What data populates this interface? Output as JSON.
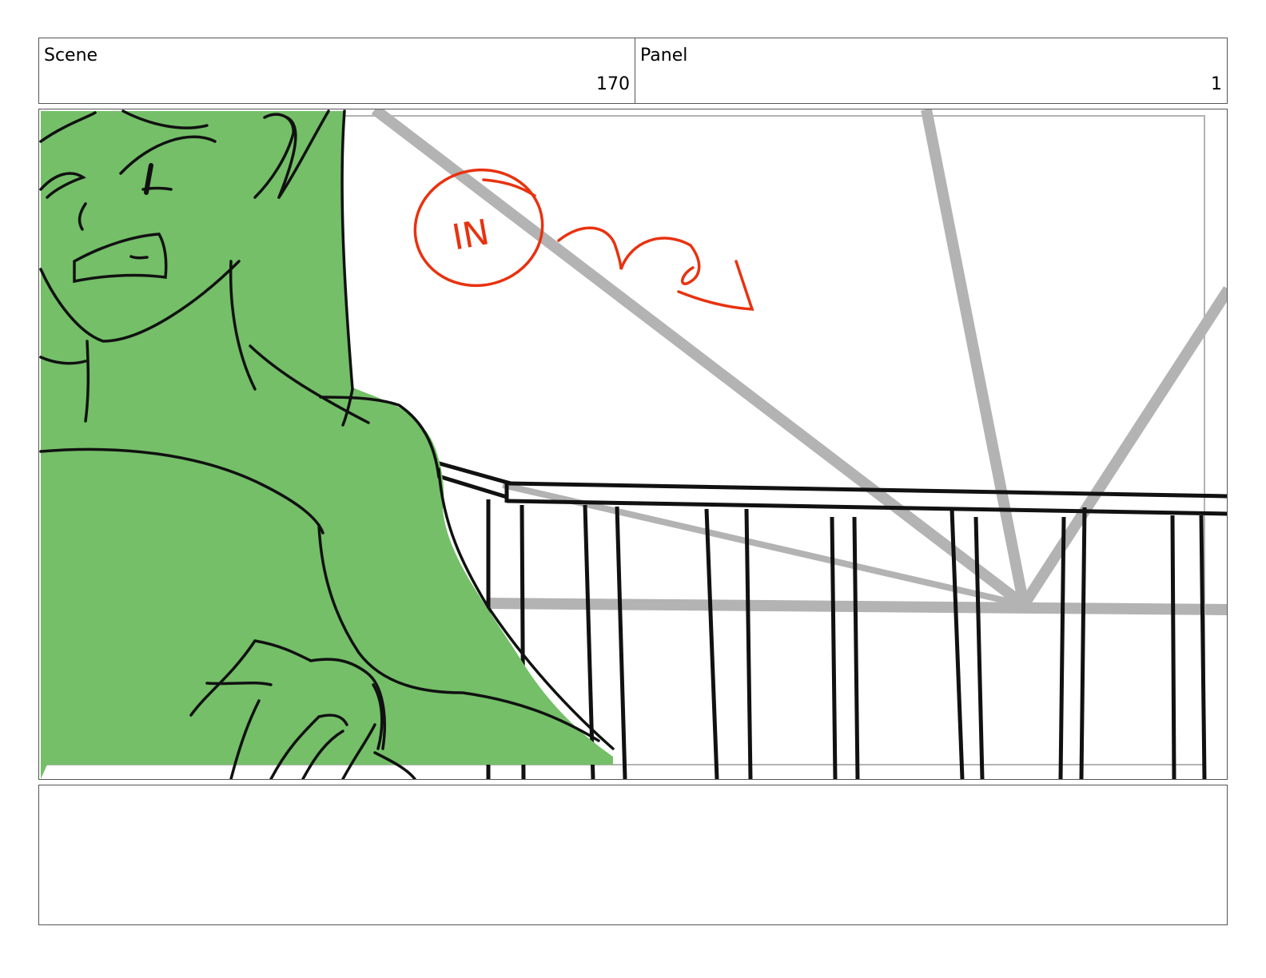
{
  "header": {
    "scene_label": "Scene",
    "scene_number": "170",
    "panel_label": "Panel",
    "panel_number": "1"
  },
  "annotation": {
    "text": "IN"
  },
  "colors": {
    "character_fill": "#74bf68",
    "sketch_line": "#111111",
    "perspective_guide": "#b3b3b3",
    "annotation_red": "#e8320f",
    "border": "#555555"
  },
  "notes": {
    "text": ""
  }
}
